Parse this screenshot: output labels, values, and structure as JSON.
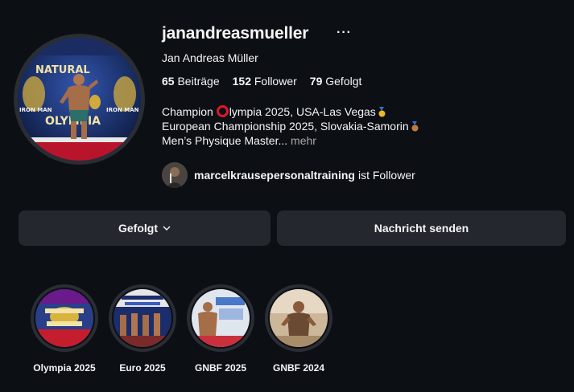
{
  "profile": {
    "username": "janandreasmueller",
    "more": "···",
    "full_name": "Jan Andreas Müller",
    "stats": {
      "posts_count": "65",
      "posts_label": "Beiträge",
      "followers_count": "152",
      "followers_label": "Follower",
      "following_count": "79",
      "following_label": "Gefolgt"
    },
    "bio": {
      "line1_pre": "Champion ",
      "line1_post": "lympia 2025, USA-Las Vegas",
      "line2": "European Championship 2025, Slovakia-Samorin",
      "line3": "Men’s Physique Master...",
      "more_label": "mehr"
    },
    "followed_by": {
      "username": "marcelkrausepersonaltraining",
      "suffix": "ist Follower"
    }
  },
  "actions": {
    "following_label": "Gefolgt",
    "message_label": "Nachricht senden"
  },
  "highlights": [
    {
      "label": "Olympia 2025"
    },
    {
      "label": "Euro 2025"
    },
    {
      "label": "GNBF 2025"
    },
    {
      "label": "GNBF 2024"
    }
  ],
  "avatar_poster_text": {
    "natural": "NATURAL",
    "olympia": "OLYMPIA",
    "iron_man": "IRON MAN"
  },
  "colors": {
    "background": "#0c0f14",
    "button": "#24272e",
    "muted": "#a8a8a8",
    "olympia_red": "#e0162b"
  }
}
